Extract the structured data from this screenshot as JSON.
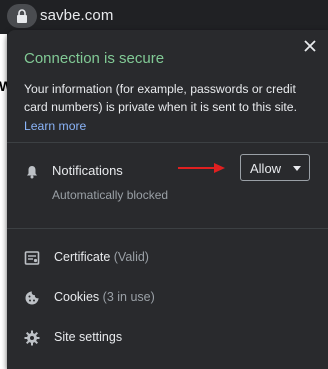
{
  "omnibox": {
    "url": "savbe.com"
  },
  "background": {
    "partial_letter": "W"
  },
  "popup": {
    "title": "Connection is secure",
    "description": "Your information (for example, passwords or credit card numbers) is private when it is sent to this site.",
    "learn_more": "Learn more",
    "notifications": {
      "label": "Notifications",
      "status": "Automatically blocked",
      "selected": "Allow"
    },
    "items": [
      {
        "label": "Certificate",
        "sub": "(Valid)",
        "icon": "certificate-icon"
      },
      {
        "label": "Cookies",
        "sub": "(3 in use)",
        "icon": "cookie-icon"
      },
      {
        "label": "Site settings",
        "sub": "",
        "icon": "gear-icon"
      }
    ]
  },
  "colors": {
    "secure_green": "#81c995",
    "link_blue": "#8ab4f8",
    "arrow_red": "#e02020",
    "popup_bg": "#292a2d"
  }
}
